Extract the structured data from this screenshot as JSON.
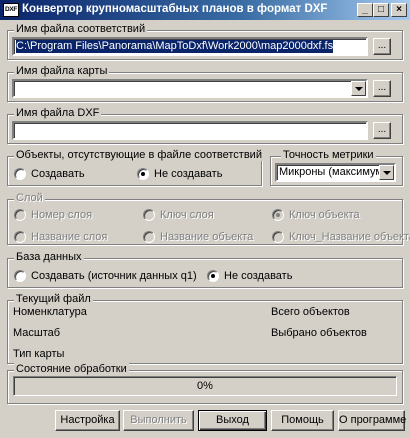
{
  "window": {
    "icon_text": "DXF",
    "title": "Конвертор крупномасштабных планов в формат DXF",
    "minimize": "_",
    "maximize": "□",
    "close": "×"
  },
  "correspondence_file": {
    "legend": "Имя файла соответствий",
    "value": "C:\\Program Files\\Panorama\\MapToDxf\\Work2000\\map2000dxf.fs",
    "browse": "..."
  },
  "map_file": {
    "legend": "Имя файла карты",
    "value": "",
    "browse": "..."
  },
  "dxf_file": {
    "legend": "Имя файла DXF",
    "value": "",
    "browse": "..."
  },
  "missing_objects": {
    "legend": "Объекты, отсутствующие в файле соответствий",
    "create": "Создавать",
    "dont_create": "Не создавать",
    "selected": "dont_create"
  },
  "precision": {
    "legend": "Точность метрики",
    "value": "Микроны (максимум)"
  },
  "layer": {
    "legend": "Слой",
    "options": [
      "Номер слоя",
      "Ключ слоя",
      "Ключ объекта",
      "Название слоя",
      "Название объекта",
      "Ключ_Название объекта"
    ],
    "selected": "Ключ объекта",
    "enabled": false
  },
  "database": {
    "legend": "База данных",
    "create": "Создавать (источник данных q1)",
    "dont_create": "Не создавать",
    "selected": "dont_create"
  },
  "current_file": {
    "legend": "Текущий файл",
    "nomenclature": "Номенклатура",
    "scale": "Масштаб",
    "map_type": "Тип карты",
    "total_objects": "Всего объектов",
    "selected_objects": "Выбрано объектов"
  },
  "processing": {
    "legend": "Состояние обработки",
    "progress_text": "0%",
    "progress": 0
  },
  "buttons": {
    "settings": "Настройка",
    "run": "Выполнить",
    "exit": "Выход",
    "help": "Помощь",
    "about": "О программе"
  }
}
